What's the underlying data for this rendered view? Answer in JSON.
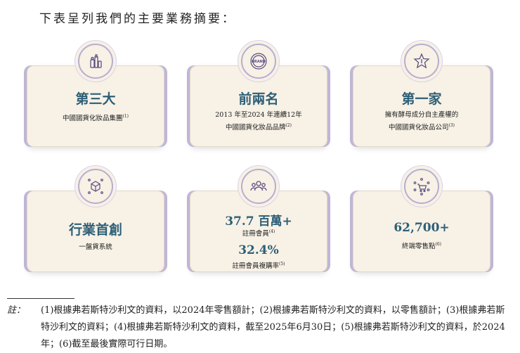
{
  "intro": "下表呈列我們的主要業務摘要：",
  "cards": [
    {
      "icon": "cosmetics-icon",
      "title": "第三大",
      "lines": [
        "中國國貨化妝品集團"
      ],
      "sup": "(1)"
    },
    {
      "icon": "brand-badge-icon",
      "badge_text": "BRAND",
      "title": "前兩名",
      "lines": [
        "2013 年至2024 年連續12年",
        "中國國貨化妝品品牌"
      ],
      "sup": "(2)"
    },
    {
      "icon": "star-award-icon",
      "title": "第一家",
      "lines": [
        "擁有酵母成分自主產權的",
        "中國國貨化妝品公司"
      ],
      "sup": "(3)"
    },
    {
      "icon": "cube-network-icon",
      "title": "行業首創",
      "lines": [
        "一盤貨系統"
      ],
      "sup": ""
    },
    {
      "icon": "users-group-icon",
      "stat1": "37.7 百萬+",
      "stat1_label": "註冊會員",
      "stat1_sup": "(4)",
      "stat2": "32.4%",
      "stat2_label": "註冊會員複購率",
      "stat2_sup": "(5)"
    },
    {
      "icon": "shopping-cart-network-icon",
      "stat1": "62,700+",
      "stat1_label": "終端零售點",
      "stat1_sup": "(6)"
    }
  ],
  "notes_label": "註：",
  "notes_text": "(1)根據弗若斯特沙利文的資料，以2024年零售額計；(2)根據弗若斯特沙利文的資料，以零售額計；(3)根據弗若斯特沙利文的資料；(4)根據弗若斯特沙利文的資料，截至2025年6月30日；(5)根據弗若斯特沙利文的資料，於2024年；(6)截至最後實際可行日期。"
}
